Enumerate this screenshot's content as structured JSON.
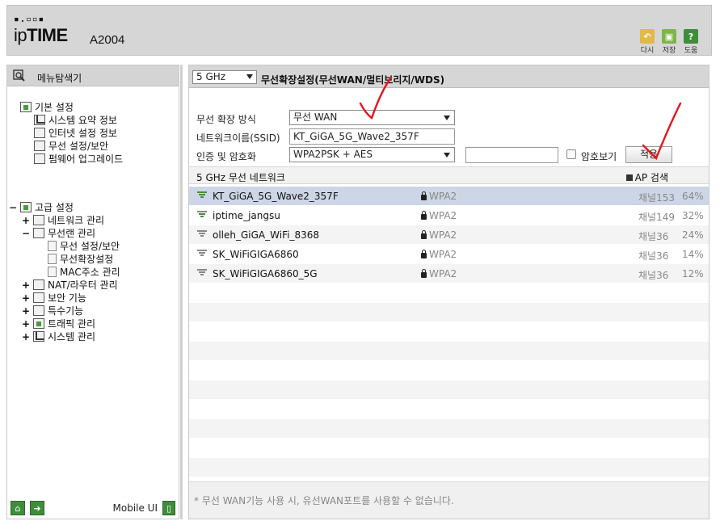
{
  "header": {
    "logo_dots": "▪.▫▫▪",
    "logo_ip": "ip",
    "logo_time": "TIME",
    "model": "A2004",
    "buttons": [
      {
        "label": "다시",
        "color": "#e2b84a",
        "icon": "undo-icon"
      },
      {
        "label": "저장",
        "color": "#7cb649",
        "icon": "save-icon"
      },
      {
        "label": "도움",
        "color": "#3e8d3a",
        "icon": "help-icon"
      }
    ]
  },
  "sidebar": {
    "title": "메뉴탐색기",
    "basic": {
      "label": "기본 설정",
      "items": [
        "시스템 요약 정보",
        "인터넷 설정 정보",
        "무선 설정/보안",
        "펌웨어 업그레이드"
      ]
    },
    "advanced": {
      "label": "고급 설정",
      "network": "네트워크 관리",
      "wireless": "무선랜 관리",
      "wireless_items": [
        "무선 설정/보안",
        "무선확장설정",
        "MAC주소 관리"
      ],
      "others": [
        "NAT/라우터 관리",
        "보안 기능",
        "특수기능",
        "트래픽 관리",
        "시스템 관리"
      ]
    },
    "mobile_label": "Mobile UI"
  },
  "main": {
    "band": "5 GHz",
    "title": "무선확장설정(무선WAN/멀티브리지/WDS)",
    "form": {
      "mode_label": "무선 확장 방식",
      "mode_value": "무선 WAN",
      "ssid_label": "네트워크이름(SSID)",
      "ssid_value": "KT_GiGA_5G_Wave2_357F",
      "auth_label": "인증 및 암호화",
      "auth_value": "WPA2PSK + AES",
      "password_value": "",
      "show_password_label": "암호보기",
      "apply_label": "적용"
    },
    "network_header": "5 GHz 무선 네트워크",
    "ap_search_label": "AP 검색",
    "networks": [
      {
        "ssid": "KT_GiGA_5G_Wave2_357F",
        "security": "WPA2",
        "channel": "채널153",
        "signal": "64%"
      },
      {
        "ssid": "iptime_jangsu",
        "security": "WPA2",
        "channel": "채널149",
        "signal": "32%"
      },
      {
        "ssid": "olleh_GiGA_WiFi_8368",
        "security": "WPA2",
        "channel": "채널36",
        "signal": "24%"
      },
      {
        "ssid": "SK_WiFiGIGA6860",
        "security": "WPA2",
        "channel": "채널36",
        "signal": "14%"
      },
      {
        "ssid": "SK_WiFiGIGA6860_5G",
        "security": "WPA2",
        "channel": "채널36",
        "signal": "12%"
      }
    ],
    "note": "* 무선 WAN기능 사용 시, 유선WAN포트를 사용할 수 없습니다."
  }
}
